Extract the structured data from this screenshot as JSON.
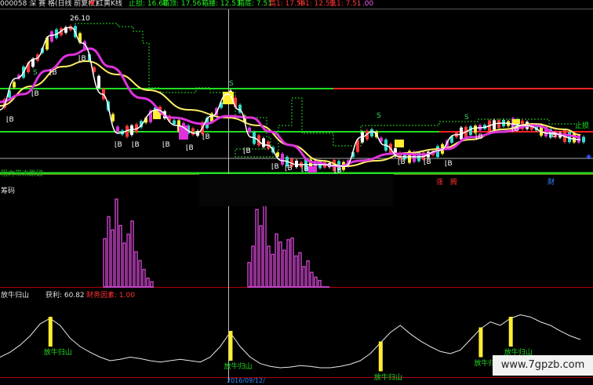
{
  "header": {
    "code_title": "000058 深 赛 格(日线 前复权)",
    "indicator_name": "红黄K线",
    "stop_loss": "止损: 16.68",
    "box_top": "箱顶: 17.56",
    "box_mid": "箱腰: 12.53",
    "box_bottom": "箱底: 7.51",
    "high": "高1: 17.56",
    "mid": "中1: 12.53",
    "low": "低1: 7.51",
    "tail": ": .00"
  },
  "main_panel": {
    "peak_label": "26.10",
    "stop_label": "止损",
    "signal_b": "B",
    "signal_s": "S",
    "left_caption": "阻力带未跌破",
    "event_up": "涨",
    "event_rise": "腾",
    "event_fin": "财",
    "right_marker": "◉"
  },
  "chip_panel": {
    "title": "筹码",
    "bars_a": [
      0.55,
      0.8,
      0.65,
      1.0,
      0.7,
      0.5,
      0.6,
      0.75,
      0.4,
      0.3,
      0.2,
      0.1,
      0.06
    ],
    "bars_b": [
      0.3,
      0.5,
      0.95,
      0.75,
      1.0,
      0.5,
      0.4,
      0.65,
      0.55,
      0.45,
      0.58,
      0.6,
      0.38,
      0.42,
      0.25,
      0.32,
      0.18,
      0.12,
      0.08
    ]
  },
  "osc_panel": {
    "title": "放牛归山",
    "profit_label": "获利: 60.82",
    "sub_label": "财务因素: 1.00",
    "signal_text": "放牛归山",
    "values": [
      0.25,
      0.32,
      0.42,
      0.55,
      0.72,
      0.8,
      0.7,
      0.52,
      0.4,
      0.32,
      0.25,
      0.2,
      0.22,
      0.25,
      0.23,
      0.2,
      0.18,
      0.2,
      0.22,
      0.2,
      0.18,
      0.25,
      0.4,
      0.6,
      0.4,
      0.25,
      0.16,
      0.12,
      0.1,
      0.11,
      0.13,
      0.12,
      0.1,
      0.1,
      0.12,
      0.15,
      0.2,
      0.3,
      0.45,
      0.6,
      0.7,
      0.58,
      0.48,
      0.4,
      0.33,
      0.3,
      0.35,
      0.5,
      0.65,
      0.75,
      0.7,
      0.8,
      0.85,
      0.82,
      0.75,
      0.7,
      0.62,
      0.55,
      0.5
    ],
    "signals": [
      5,
      23,
      38,
      48,
      51
    ]
  },
  "footer": {
    "date_fragment": "2016/09/12/",
    "watermark": "www.7gpzb.com"
  },
  "colors": {
    "up": "#ff3a3a",
    "down": "#33ddcc",
    "white_ma": "#ffffff",
    "magenta_ma": "#dd33dd",
    "yellow_ma": "#ffee66",
    "green_line": "#22dd22",
    "red_line": "#ff2222",
    "chip": "#c040c0",
    "osc_line": "#e8e8e8",
    "signal_bar": "#ffee33"
  }
}
